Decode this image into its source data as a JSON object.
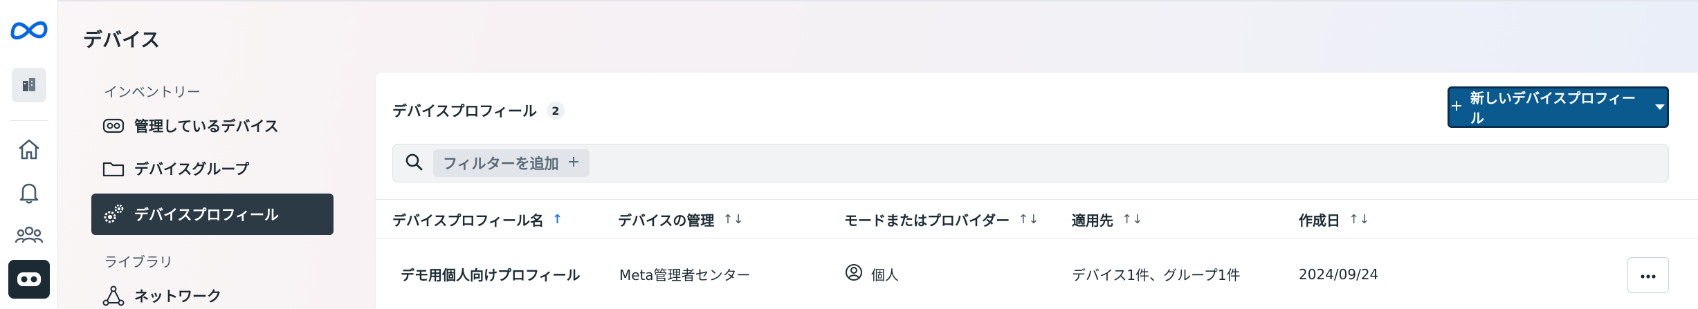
{
  "page": {
    "title": "デバイス"
  },
  "sidebar": {
    "sections": [
      {
        "label": "インベントリー"
      },
      {
        "label": "ライブラリ"
      }
    ],
    "items": [
      {
        "label": "管理しているデバイス",
        "icon": "headset-icon"
      },
      {
        "label": "デバイスグループ",
        "icon": "folder-icon"
      },
      {
        "label": "デバイスプロフィール",
        "icon": "gears-icon",
        "active": true
      },
      {
        "label": "ネットワーク",
        "icon": "network-icon"
      }
    ]
  },
  "rail": {
    "icons": [
      "meta-logo-icon",
      "organization-icon",
      "home-icon",
      "bell-icon",
      "people-icon",
      "headset-icon"
    ]
  },
  "card": {
    "title": "デバイスプロフィール",
    "count": "2",
    "new_button_label": "新しいデバイスプロフィール",
    "filter_chip_label": "フィルターを追加"
  },
  "table": {
    "columns": [
      {
        "label": "デバイスプロフィール名",
        "sort": "↑"
      },
      {
        "label": "デバイスの管理",
        "sort": "↑↓"
      },
      {
        "label": "モードまたはプロバイダー",
        "sort": "↑↓"
      },
      {
        "label": "適用先",
        "sort": "↑↓"
      },
      {
        "label": "作成日",
        "sort": "↑↓"
      }
    ],
    "rows": [
      {
        "name": "デモ用個人向けプロフィール",
        "management": "Meta管理者センター",
        "mode": "個人",
        "applied_to": "デバイス1件、グループ1件",
        "created": "2024/09/24"
      }
    ]
  },
  "colors": {
    "primary_button": "#0b5a8f",
    "active_nav": "#2b3a45",
    "sort_active": "#1877f2"
  }
}
